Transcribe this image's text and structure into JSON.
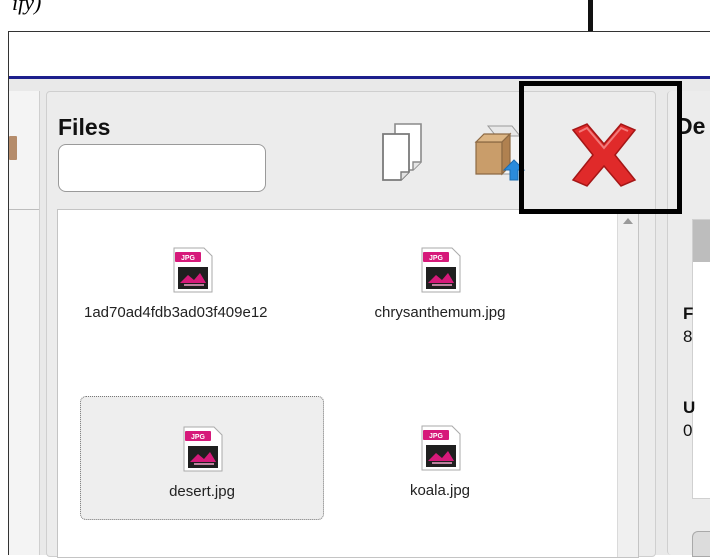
{
  "caption": {
    "text": "ify)"
  },
  "files_panel": {
    "title": "Files",
    "search": {
      "value": "",
      "placeholder": ""
    },
    "toolbar": [
      {
        "name": "copy-button",
        "icon": "copy-documents-icon"
      },
      {
        "name": "upload-button",
        "icon": "upload-box-icon"
      },
      {
        "name": "delete-button",
        "icon": "delete-x-icon"
      }
    ],
    "files": [
      {
        "name": "1ad70ad4fdb3ad03f409e12",
        "icon": "jpg-file-icon",
        "selected": false
      },
      {
        "name": "chrysanthemum.jpg",
        "icon": "jpg-file-icon",
        "selected": false
      },
      {
        "name": "desert.jpg",
        "icon": "jpg-file-icon",
        "selected": true
      },
      {
        "name": "koala.jpg",
        "icon": "jpg-file-icon",
        "selected": false
      }
    ]
  },
  "details_panel": {
    "title": "De",
    "rows": [
      "F",
      "8",
      "U",
      "0"
    ]
  },
  "colors": {
    "accent_bar": "#1c1f8c",
    "delete_red": "#e02a2a",
    "jpg_magenta": "#d6197a"
  }
}
